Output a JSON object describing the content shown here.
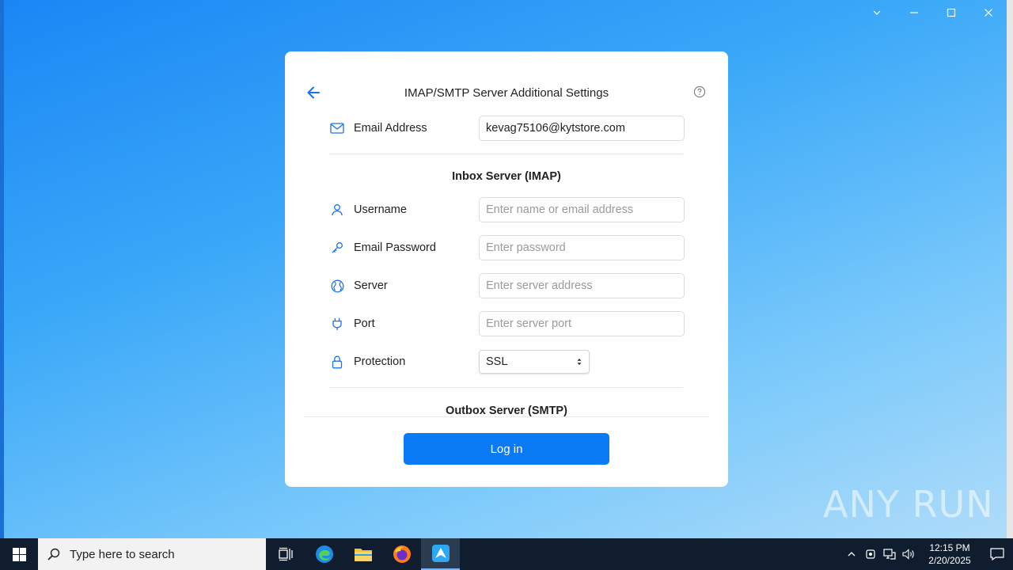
{
  "dialog": {
    "title": "IMAP/SMTP Server Additional Settings",
    "email_label": "Email Address",
    "email_value": "kevag75106@kytstore.com",
    "inbox_section": "Inbox Server (IMAP)",
    "username_label": "Username",
    "username_placeholder": "Enter name or email address",
    "password_label": "Email Password",
    "password_placeholder": "Enter password",
    "server_label": "Server",
    "server_placeholder": "Enter server address",
    "port_label": "Port",
    "port_placeholder": "Enter server port",
    "protection_label": "Protection",
    "protection_value": "SSL",
    "outbox_section": "Outbox Server (SMTP)",
    "login_label": "Log in"
  },
  "watermark": {
    "text": "ANY RUN"
  },
  "taskbar": {
    "search_placeholder": "Type here to search",
    "time": "12:15 PM",
    "date": "2/20/2025"
  },
  "colors": {
    "accent": "#0a7af5",
    "icon_blue": "#1a73e8",
    "taskbar": "#0f1d2e"
  }
}
